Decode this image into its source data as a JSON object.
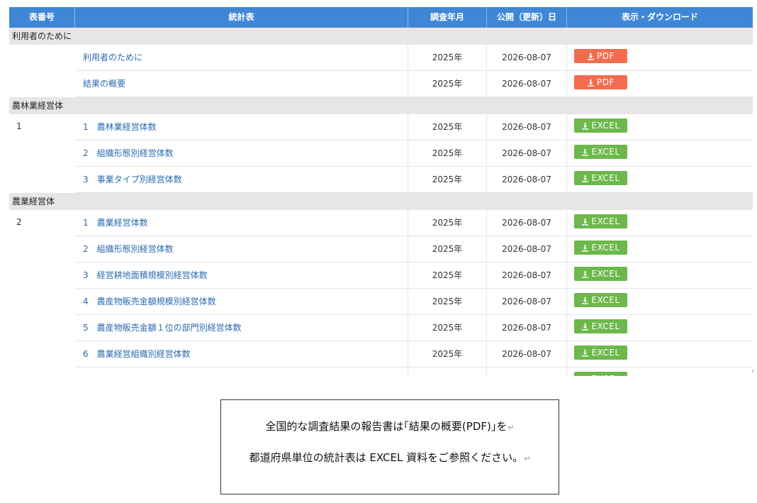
{
  "table": {
    "headers": [
      "表番号",
      "統計表",
      "調査年月",
      "公開（更新）日",
      "表示・ダウンロード"
    ],
    "sections": [
      {
        "label": "利用者のために",
        "number": "",
        "rows": [
          {
            "title": "利用者のために",
            "year": "2025年",
            "date": "2026-08-07",
            "format": "PDF"
          },
          {
            "title": "結果の概要",
            "year": "2025年",
            "date": "2026-08-07",
            "format": "PDF"
          }
        ]
      },
      {
        "label": "農林業経営体",
        "number": "1",
        "rows": [
          {
            "title": "1　農林業経営体数",
            "year": "2025年",
            "date": "2026-08-07",
            "format": "EXCEL"
          },
          {
            "title": "2　組織形態別経営体数",
            "year": "2025年",
            "date": "2026-08-07",
            "format": "EXCEL"
          },
          {
            "title": "3　事業タイプ別経営体数",
            "year": "2025年",
            "date": "2026-08-07",
            "format": "EXCEL"
          }
        ]
      },
      {
        "label": "農業経営体",
        "number": "2",
        "rows": [
          {
            "title": "1　農業経営体数",
            "year": "2025年",
            "date": "2026-08-07",
            "format": "EXCEL"
          },
          {
            "title": "2　組織形態別経営体数",
            "year": "2025年",
            "date": "2026-08-07",
            "format": "EXCEL"
          },
          {
            "title": "3　経営耕地面積規模別経営体数",
            "year": "2025年",
            "date": "2026-08-07",
            "format": "EXCEL"
          },
          {
            "title": "4　農産物販売金額規模別経営体数",
            "year": "2025年",
            "date": "2026-08-07",
            "format": "EXCEL"
          },
          {
            "title": "5　農産物販売金額１位の部門別経営体数",
            "year": "2025年",
            "date": "2026-08-07",
            "format": "EXCEL"
          },
          {
            "title": "6　農業経営組織別経営体数",
            "year": "2025年",
            "date": "2026-08-07",
            "format": "EXCEL"
          },
          {
            "title": "",
            "year": "",
            "date": "",
            "format": "EXCEL"
          }
        ]
      }
    ]
  },
  "note": {
    "line1": "全国的な調査結果の報告書は｢結果の概要(PDF)｣を",
    "line2": "都道府県単位の統計表は EXCEL 資料をご参照ください。",
    "return_mark": "↵"
  },
  "colors": {
    "header_bg": "#3f87d6",
    "section_bg": "#e6e6e6",
    "link": "#2a6ab0",
    "pdf_button": "#f26d4f",
    "excel_button": "#6cb84a"
  },
  "icons": {
    "download": "download-icon",
    "scroll": "scroll-arrow-icon"
  }
}
